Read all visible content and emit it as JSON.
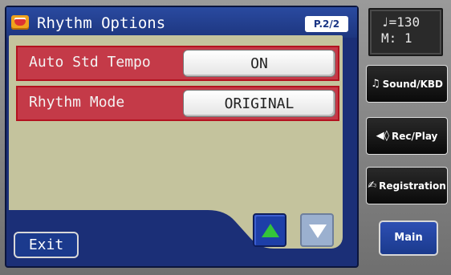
{
  "header": {
    "title": "Rhythm Options",
    "page": "P.2/2",
    "title_icon": "drum-icon"
  },
  "settings": [
    {
      "label": "Auto Std Tempo",
      "value": "ON"
    },
    {
      "label": "Rhythm Mode",
      "value": "ORIGINAL"
    }
  ],
  "footer": {
    "exit_label": "Exit",
    "up_icon": "arrow-up-icon",
    "down_icon": "arrow-down-icon"
  },
  "status": {
    "tempo": "♩=130",
    "measure": "M:  1"
  },
  "side_buttons": [
    {
      "label": "Sound/KBD",
      "icon": "♫"
    },
    {
      "label": "Rec/Play",
      "icon": "◀◊"
    },
    {
      "label": "Registration",
      "icon": "✍"
    }
  ],
  "main_label": "Main",
  "colors": {
    "lcd_blue": "#1b2f77",
    "panel_bg": "#c4c39d",
    "row_red": "#c43a48",
    "arrow_green": "#33c43a"
  }
}
